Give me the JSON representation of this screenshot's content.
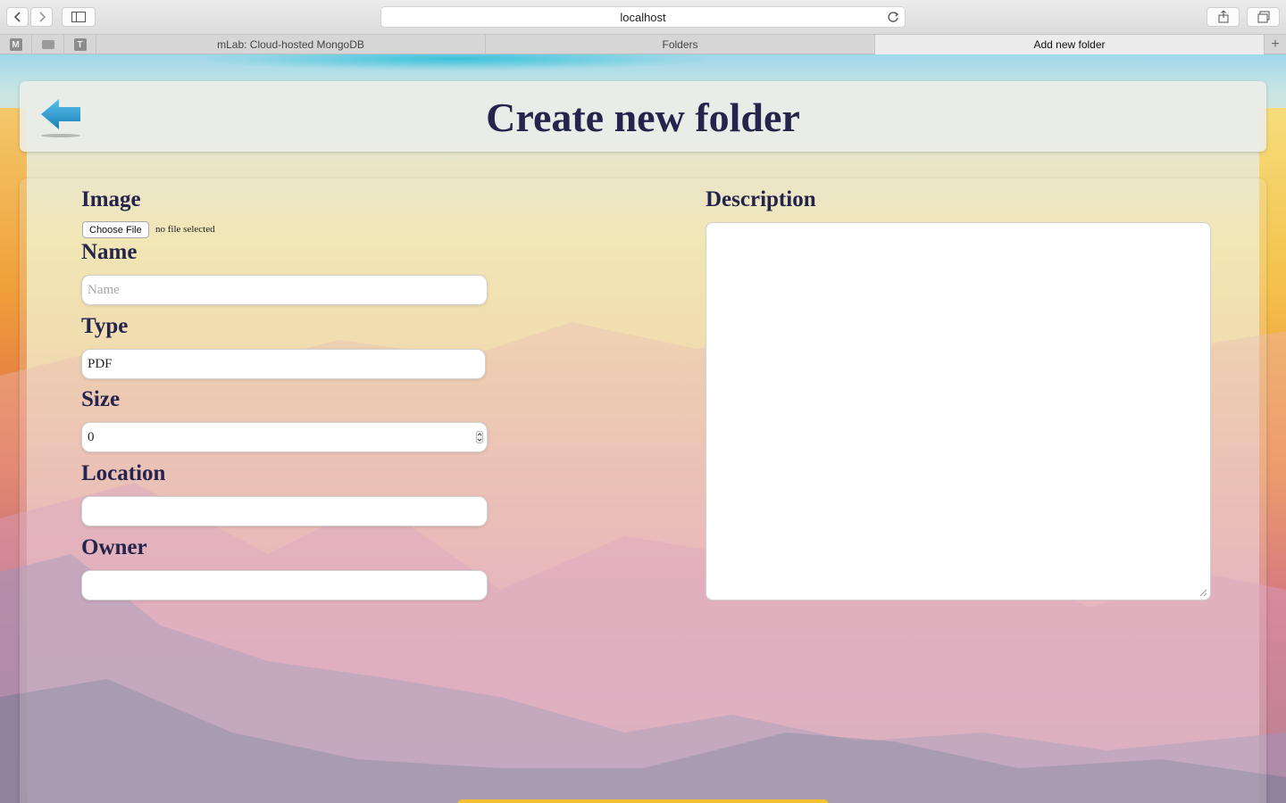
{
  "browser": {
    "url": "localhost",
    "tabs": [
      {
        "label": "mLab: Cloud-hosted MongoDB",
        "active": false
      },
      {
        "label": "Folders",
        "active": false
      },
      {
        "label": "Add new folder",
        "active": true
      }
    ],
    "pinned": [
      "M",
      "",
      "T"
    ]
  },
  "header": {
    "title": "Create new folder"
  },
  "form": {
    "image_label": "Image",
    "choose_file_label": "Choose File",
    "file_status": "no file selected",
    "name_label": "Name",
    "name_placeholder": "Name",
    "name_value": "",
    "type_label": "Type",
    "type_value": "PDF",
    "size_label": "Size",
    "size_value": "0",
    "location_label": "Location",
    "location_value": "",
    "owner_label": "Owner",
    "owner_value": "",
    "description_label": "Description",
    "description_value": ""
  },
  "colors": {
    "title_text": "#25244c",
    "submit_accent": "#f3c02f",
    "back_arrow": "#1f8fc7"
  }
}
